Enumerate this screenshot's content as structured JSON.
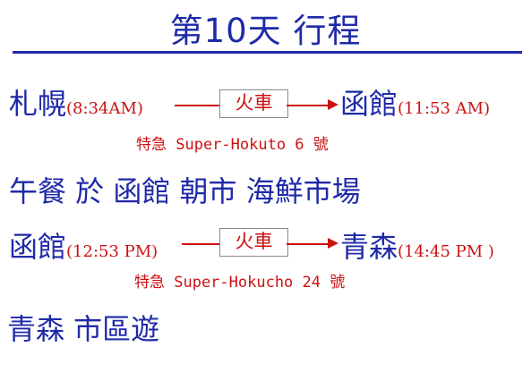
{
  "title": "第10天 行程",
  "segment1": {
    "from": "札幌",
    "depart": "(8:34AM)",
    "mode": "火車",
    "to": "函館",
    "arrive": "(11:53 AM)",
    "service": "特急 Super-Hokuto 6 號"
  },
  "lunch": "午餐 於 函館 朝市 海鮮市場",
  "segment2": {
    "from": "函館",
    "depart": "(12:53 PM)",
    "mode": "火車",
    "to": "青森",
    "arrive": "(14:45 PM )",
    "service": "特急 Super-Hokucho 24 號"
  },
  "tour": "青森 市區遊",
  "colors": {
    "heading": "#1f2aa8",
    "accent": "#cc1111"
  }
}
